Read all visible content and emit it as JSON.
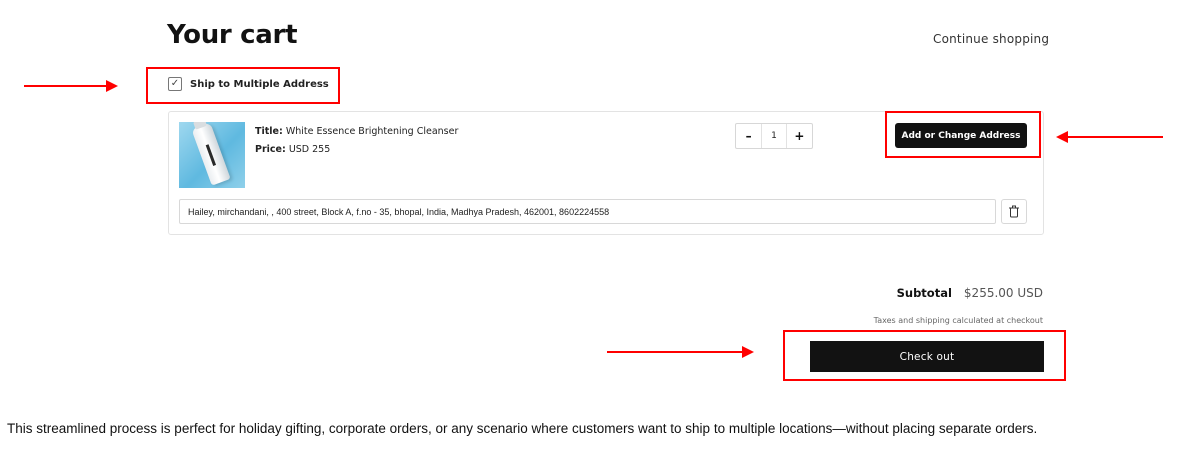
{
  "header": {
    "title": "Your cart",
    "continue_label": "Continue shopping"
  },
  "options": {
    "ship_multiple_label": "Ship to Multiple Address",
    "ship_multiple_checked": true
  },
  "cart_item": {
    "title_label": "Title:",
    "title": "White Essence Brightening Cleanser",
    "price_label": "Price:",
    "price": "USD 255",
    "quantity": "1",
    "decrement_symbol": "–",
    "increment_symbol": "+",
    "address_button_label": "Add or Change Address",
    "address": "Hailey, mirchandani, , 400 street, Block A, f.no - 35, bhopal, India, Madhya Pradesh, 462001, 8602224558"
  },
  "summary": {
    "subtotal_label": "Subtotal",
    "subtotal_value": "$255.00 USD",
    "tax_note": "Taxes and shipping calculated at checkout",
    "checkout_label": "Check out"
  },
  "caption": "This streamlined process is perfect for holiday gifting, corporate orders, or any scenario where customers want to ship to multiple locations—without placing separate orders.",
  "colors": {
    "annotation": "#ff0000",
    "button_bg": "#121212",
    "button_text": "#ffffff"
  },
  "icons": [
    "check-icon",
    "trash-icon",
    "arrow-right-icon",
    "arrow-left-icon"
  ]
}
